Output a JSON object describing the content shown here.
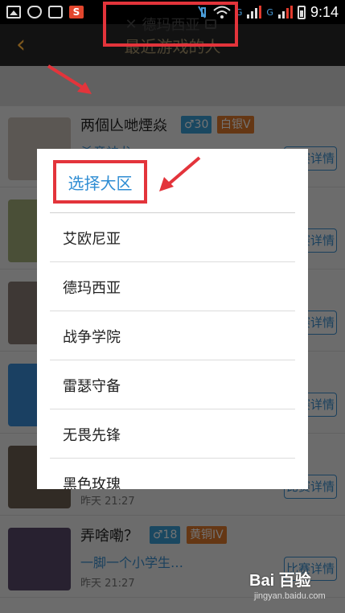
{
  "status_bar": {
    "time": "9:14",
    "signal_1": "G",
    "signal_2": "G"
  },
  "titlebar": {
    "back_glyph": "‹",
    "title": "最近游戏的人"
  },
  "filter": {
    "close_glyph": "✕",
    "label": "德玛西亚",
    "chevron_glyph": "⌄"
  },
  "list": {
    "rows": [
      {
        "name": "两個亾哋煙焱",
        "gender": "♂30",
        "rank": "白银V",
        "message": "杀意神龙…",
        "time": "",
        "button": "比赛详情"
      },
      {
        "name": "",
        "gender": "",
        "rank": "",
        "message": "",
        "time": "",
        "button": "比赛详情"
      },
      {
        "name": "",
        "gender": "",
        "rank": "",
        "message": "",
        "time": "",
        "button": "比赛详情"
      },
      {
        "name": "",
        "gender": "",
        "rank": "",
        "message": "",
        "time": "",
        "button": "比赛详情"
      },
      {
        "name": "",
        "gender": "",
        "rank": "",
        "message": "",
        "time": "昨天 21:27",
        "button": "比赛详情"
      },
      {
        "name": "弄啥嘞？",
        "gender": "♂18",
        "rank": "黄铜IV",
        "message": "一脚一个小学生…",
        "time": "昨天 21:27",
        "button": "比赛详情"
      }
    ]
  },
  "dialog": {
    "title": "选择大区",
    "options": [
      "艾欧尼亚",
      "德玛西亚",
      "战争学院",
      "雷瑟守备",
      "无畏先锋",
      "黑色玫瑰"
    ]
  },
  "watermark": {
    "main": "Bai 百验",
    "sub": "jingyan.baidu.com"
  },
  "colors": {
    "accent_blue": "#2f8dd3",
    "annotation_red": "#e3343b",
    "rank_orange": "#e07b2d"
  }
}
